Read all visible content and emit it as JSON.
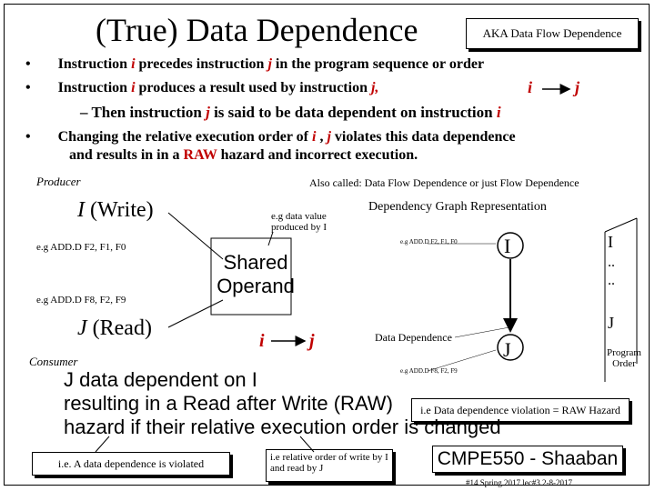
{
  "title": "(True) Data Dependence",
  "aka": "AKA Data Flow Dependence",
  "bullets": {
    "b1": {
      "pre": "Instruction ",
      "i": "i",
      "mid": " precedes instruction ",
      "j": "j",
      "post": " in the program sequence or order"
    },
    "b2": {
      "pre": "Instruction ",
      "i": "i",
      "mid": " produces a result used by instruction ",
      "j": "j,"
    },
    "b2_diagram": {
      "i": "i",
      "j": "j"
    },
    "sub": {
      "pre": "– Then instruction ",
      "j": "j",
      "mid": " is said to be data dependent on instruction ",
      "i": "i"
    },
    "b3_line1": {
      "pre": "Changing the relative execution order of ",
      "i": "i",
      "sep": " , ",
      "j": "j",
      "post": " violates this data dependence"
    },
    "b3_line2": {
      "pre": "and results in in a ",
      "raw": "RAW",
      "post": " hazard and incorrect execution."
    }
  },
  "bullet_glyph": "•",
  "producer_label": "Producer",
  "consumer_label": "Consumer",
  "also_called": "Also called:   Data Flow Dependence or  just Flow Dependence",
  "i_write": {
    "letter": "I",
    "text": " (Write)"
  },
  "j_read": {
    "letter": "J",
    "text": " (Read)"
  },
  "eg_add": "e.g  ADD.D  F2, F1, F0",
  "eg_add2": "e.g  ADD.D  F8, F2, F9",
  "eg_value": "e.g data value produced by I",
  "shared_operand": "Shared Operand",
  "ij_arrow": {
    "i": "i",
    "j": "j"
  },
  "dep_graph_title": "Dependency Graph Representation",
  "graph_eg1": "e.g  ADD.D  F2, F1, F0",
  "graph_eg2": "e.g  ADD.D  F8, F2, F9",
  "graph_I": "I",
  "graph_J": "J",
  "data_dependence_label": "Data Dependence",
  "program_order": {
    "I": "I",
    "dots1": "..",
    "dots2": "..",
    "J": "J",
    "label": "Program Order"
  },
  "conclusion": [
    "J data dependent on I",
    "resulting in a Read after Write  (RAW)",
    "hazard if their relative execution order is changed"
  ],
  "violation_box": "i.e Data dependence violation = RAW Hazard",
  "callout1": "i.e.  A data dependence is violated",
  "callout2": "i.e relative order of write by I and read by J",
  "course": "CMPE550 - Shaaban",
  "footer": "#14  Spring 2017  lec#3  2-8-2017"
}
